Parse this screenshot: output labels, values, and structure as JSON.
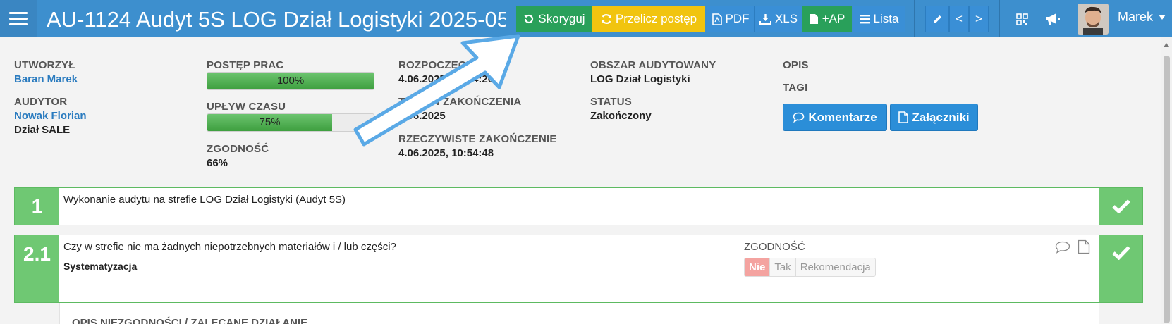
{
  "header": {
    "title": "AU-1124 Audyt 5S LOG Dział Logistyki 2025-05-",
    "buttons": {
      "skoryguj": "Skoryguj",
      "przelicz": "Przelicz postęp",
      "pdf": "PDF",
      "xls": "XLS",
      "ap": "+AP",
      "lista": "Lista"
    },
    "nav_prev": "<",
    "nav_next": ">",
    "user": "Marek"
  },
  "info": {
    "utworzyl_label": "UTWORZYŁ",
    "utworzyl_value": "Baran Marek",
    "audytor_label": "AUDYTOR",
    "audytor_value": "Nowak Florian",
    "audytor_dept": "Dział SALE",
    "postep_label": "POSTĘP PRAC",
    "postep_value": 1.0,
    "postep_text": "100%",
    "uplyw_label": "UPŁYW CZASU",
    "uplyw_value": 0.75,
    "uplyw_text": "75%",
    "zgodnosc_label": "ZGODNOŚĆ",
    "zgodnosc_value": "66%",
    "rozpoczecie_label": "ROZPOCZĘCIE",
    "rozpoczecie_value": "4.06.2025, 10:54:20",
    "termin_label": "TERMIN ZAKOŃCZENIA",
    "termin_value": "4.06.2025",
    "rzecz_label": "RZECZYWISTE ZAKOŃCZENIE",
    "rzecz_value": "4.06.2025, 10:54:48",
    "obszar_label": "OBSZAR AUDYTOWANY",
    "obszar_value": "LOG Dział Logistyki",
    "status_label": "STATUS",
    "status_value": "Zakończony",
    "opis_label": "OPIS",
    "tagi_label": "TAGI",
    "komentarze": "Komentarze",
    "zalaczniki": "Załączniki"
  },
  "rows": [
    {
      "number": "1",
      "text": "Wykonanie audytu na strefie LOG Dział Logistyki (Audyt 5S)"
    },
    {
      "number": "2.1",
      "question": "Czy w strefie nie ma żadnych niepotrzebnych materiałów i / lub części?",
      "category": "Systematyzacja",
      "zgodnosc_label": "ZGODNOŚĆ",
      "options": [
        "Nie",
        "Tak",
        "Rekomendacja"
      ],
      "selected": "Nie",
      "sub_label": "OPIS NIEZGODNOŚCI / ZALECANE DZIAŁANIE"
    }
  ],
  "colors": {
    "header": "#3d8fce",
    "green": "#29a05a",
    "yellow": "#f1c40f",
    "blue": "#3a8fd6",
    "row_green": "#6fc873",
    "selected_red": "#f4a3a0",
    "arrow": "#5aa9e6"
  }
}
